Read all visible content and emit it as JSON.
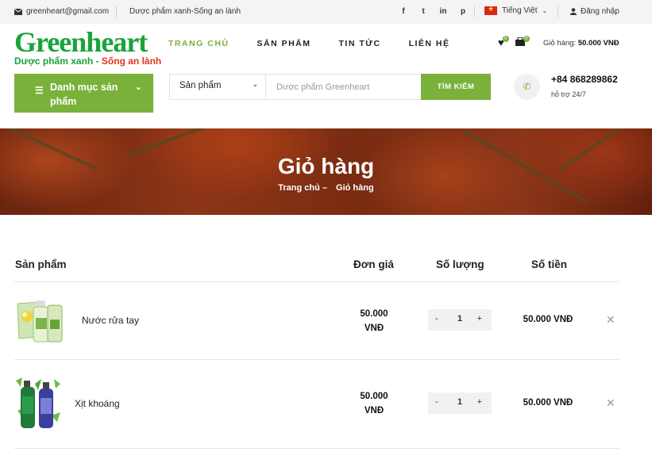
{
  "topbar": {
    "email": "greenheart@gmail.com",
    "slogan": "Dược phẩm xanh-Sống an lành",
    "socials": [
      "f",
      "t",
      "in",
      "p"
    ],
    "language": "Tiếng Việt",
    "login": "Đăng nhập"
  },
  "logo": {
    "brand": "Greenheart",
    "tagline_green": "Dược phẩm xanh - ",
    "tagline_red": "Sống an lành"
  },
  "nav": {
    "items": [
      {
        "label": "TRANG CHỦ"
      },
      {
        "label": "SẢN PHẨM"
      },
      {
        "label": "TIN TỨC"
      },
      {
        "label": "LIÊN HỆ"
      }
    ]
  },
  "header_icons": {
    "wishlist_count": "0",
    "cart_count": "0",
    "cart_label": "Giỏ hàng:",
    "cart_amount": "50.000 VNĐ"
  },
  "category_button": {
    "label": "Danh mục sản phẩm"
  },
  "search": {
    "category": "Sản phẩm",
    "placeholder": "Dược phẩm Greenheart",
    "button": "TÌM KIẾM"
  },
  "contact": {
    "phone": "+84 868289862",
    "support": "hỗ trợ 24/7"
  },
  "banner": {
    "title": "Giỏ hàng",
    "crumb_home": "Trang chủ",
    "crumb_sep": "–",
    "crumb_current": "Giỏ hàng"
  },
  "cart": {
    "headers": {
      "product": "Sản phẩm",
      "unit_price": "Đơn giá",
      "quantity": "Số lượng",
      "amount": "Số tiền"
    },
    "rows": [
      {
        "name": "Nước rửa tay",
        "price_1": "50.000",
        "price_2": "VNĐ",
        "qty": "1",
        "total": "50.000 VNĐ",
        "minus": "-",
        "plus": "+",
        "remove": "✕"
      },
      {
        "name": "Xịt khoáng",
        "price_1": "50.000",
        "price_2": "VNĐ",
        "qty": "1",
        "total": "50.000 VNĐ",
        "minus": "-",
        "plus": "+",
        "remove": "✕"
      }
    ]
  },
  "colors": {
    "accent": "#7ab13b",
    "logo_green": "#1aa33b",
    "logo_red": "#e0361f"
  }
}
